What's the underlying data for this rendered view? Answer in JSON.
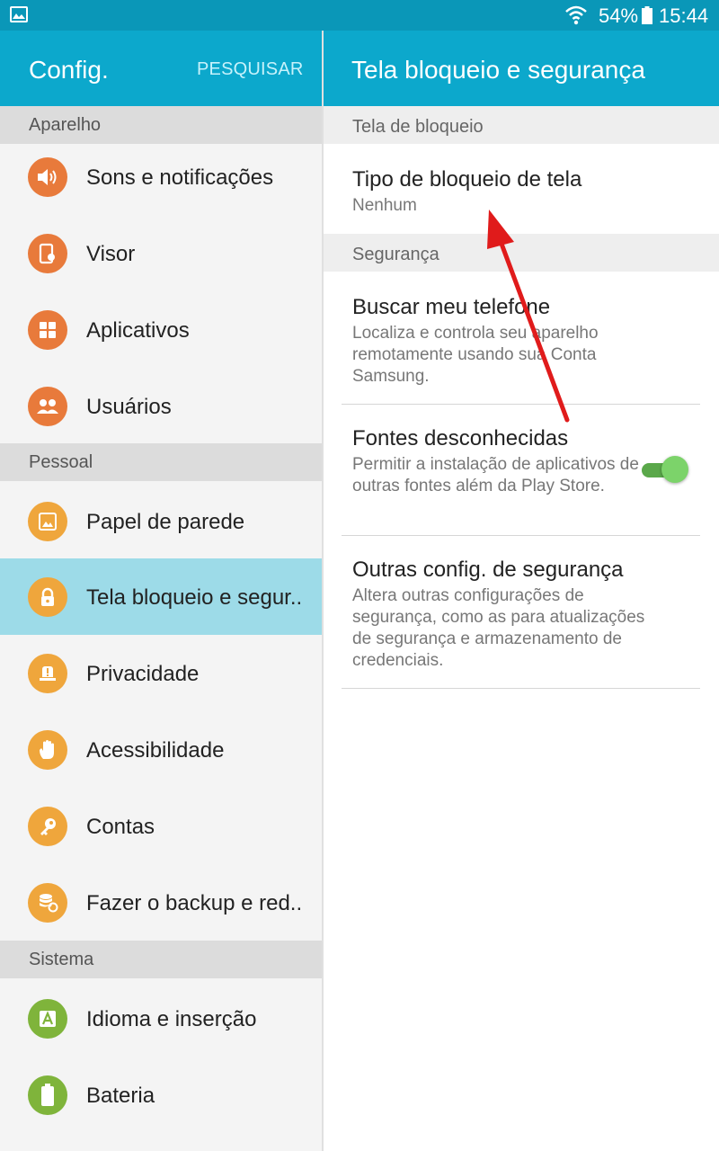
{
  "status_bar": {
    "battery_percent": "54%",
    "time": "15:44",
    "icons": [
      "gallery-icon",
      "wifi-icon",
      "battery-icon"
    ]
  },
  "left_pane": {
    "title": "Config.",
    "search_label": "PESQUISAR",
    "sections": {
      "device": "Aparelho",
      "personal": "Pessoal",
      "system": "Sistema"
    },
    "items": [
      {
        "label": "Sons e notificações",
        "icon": "sound-icon"
      },
      {
        "label": "Visor",
        "icon": "display-icon"
      },
      {
        "label": "Aplicativos",
        "icon": "apps-icon"
      },
      {
        "label": "Usuários",
        "icon": "users-icon"
      },
      {
        "label": "Papel de parede",
        "icon": "wallpaper-icon"
      },
      {
        "label": "Tela bloqueio e segur..",
        "icon": "lock-icon",
        "selected": true
      },
      {
        "label": "Privacidade",
        "icon": "privacy-icon"
      },
      {
        "label": "Acessibilidade",
        "icon": "hand-icon"
      },
      {
        "label": "Contas",
        "icon": "key-icon"
      },
      {
        "label": "Fazer o backup e red..",
        "icon": "backup-icon"
      },
      {
        "label": "Idioma e inserção",
        "icon": "language-icon"
      },
      {
        "label": "Bateria",
        "icon": "battery-icon"
      }
    ]
  },
  "right_pane": {
    "title": "Tela bloqueio e segurança",
    "sections": {
      "lock_screen": "Tela de bloqueio",
      "security": "Segurança"
    },
    "items": [
      {
        "title": "Tipo de bloqueio de tela",
        "subtitle": "Nenhum"
      },
      {
        "title": "Buscar meu telefone",
        "subtitle": "Localiza e controla seu aparelho remotamente usando sua Conta Samsung."
      },
      {
        "title": "Fontes desconhecidas",
        "subtitle": "Permitir a instalação de aplicativos de outras fontes além da Play Store.",
        "toggle_on": true
      },
      {
        "title": "Outras config. de segurança",
        "subtitle": "Altera outras configurações de segurança, como as para atualizações de segurança e armazenamento de credenciais."
      }
    ]
  },
  "colors": {
    "header": "#0ca8cc",
    "status_bar": "#0a97b8",
    "selected_item": "#9ddbe8",
    "icon_orange": "#e87a3b",
    "icon_amber": "#efa63c",
    "icon_green": "#7fb43b",
    "toggle_on": "#7cd36a",
    "annotation_arrow": "#e01b1b"
  }
}
